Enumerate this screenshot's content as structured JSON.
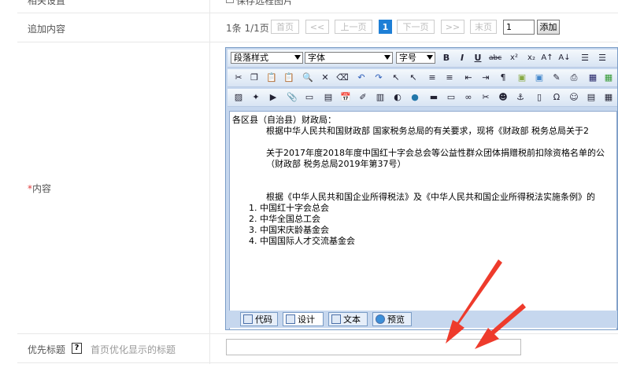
{
  "form": {
    "related_label": "相关设置",
    "related_checkbox_label": "保存远程图片",
    "append_label": "追加内容",
    "content_label": "内容",
    "required_mark": "*",
    "priority_title_label": "优先标题",
    "help_glyph": "?",
    "priority_title_hint": "首页优化显示的标题",
    "priority_title_value": ""
  },
  "pagination": {
    "summary": "1条 1/1页",
    "first": "首页",
    "prev_fast": "<<",
    "prev": "上一页",
    "current": "1",
    "next": "下一页",
    "next_fast": ">>",
    "last": "末页",
    "page_input": "1",
    "add_button": "添加"
  },
  "editor": {
    "paragraph_style": "段落样式",
    "font": "字体",
    "font_size": "字号",
    "content_lines": [
      "各区县（自治县）财政局：",
      "根据中华人民共和国财政部 国家税务总局的有关要求，现将《财政部 税务总局关于2",
      "关于2017年度2018年度中国红十字会总会等公益性群众团体捐赠税前扣除资格名单的公",
      "（财政部 税务总局2019年第37号）",
      "根据《中华人民共和国企业所得税法》及《中华人民共和国企业所得税法实施条例》的",
      "1. 中国红十字会总会",
      "2. 中华全国总工会",
      "3. 中国宋庆龄基金会",
      "4. 中国国际人才交流基金会"
    ],
    "modes": {
      "code": "代码",
      "design": "设计",
      "text": "文本",
      "preview": "预览"
    }
  },
  "colors": {
    "accent": "#1e7fd6",
    "required": "#e03c3c",
    "arrow": "#ee3b2c",
    "editor_border": "#7a9cc6"
  }
}
